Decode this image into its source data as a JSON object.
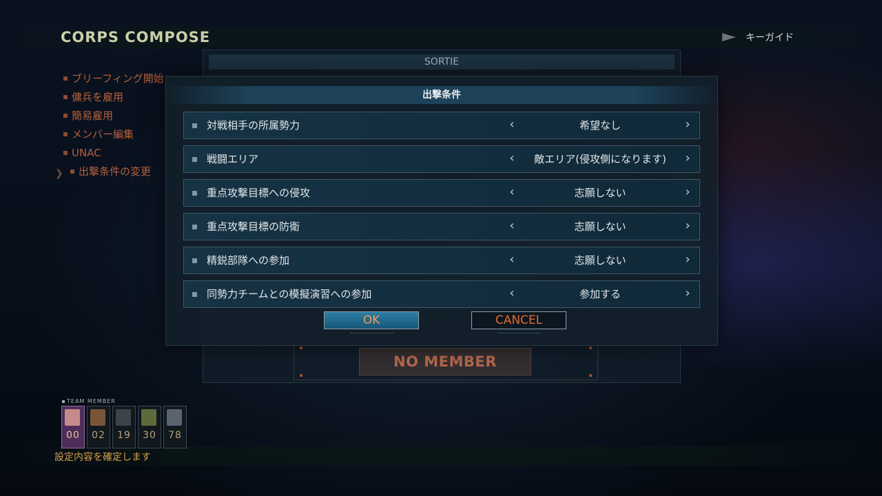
{
  "header": {
    "title": "CORPS COMPOSE",
    "key_guide": "キーガイド"
  },
  "side_menu": [
    {
      "label": "ブリーフィング開始"
    },
    {
      "label": "傭兵を雇用"
    },
    {
      "label": "簡易雇用"
    },
    {
      "label": "メンバー編集"
    },
    {
      "label": "UNAC"
    },
    {
      "label": "出撃条件の変更",
      "active": true
    }
  ],
  "background_panel": {
    "header": "SORTIE",
    "no_member": "NO MEMBER"
  },
  "dialog": {
    "title": "出撃条件",
    "rows": [
      {
        "label": "対戦相手の所属勢力",
        "value": "希望なし"
      },
      {
        "label": "戦闘エリア",
        "value": "敵エリア(侵攻側になります)"
      },
      {
        "label": "重点攻撃目標への侵攻",
        "value": "志願しない"
      },
      {
        "label": "重点攻撃目標の防衛",
        "value": "志願しない"
      },
      {
        "label": "精鋭部隊への参加",
        "value": "志願しない"
      },
      {
        "label": "同勢力チームとの模擬演習への参加",
        "value": "参加する"
      }
    ],
    "ok_label": "OK",
    "cancel_label": "CANCEL"
  },
  "team": {
    "label": "TEAM MEMBER",
    "members": [
      {
        "number": "00",
        "selected": true
      },
      {
        "number": "02"
      },
      {
        "number": "19"
      },
      {
        "number": "30"
      },
      {
        "number": "78"
      }
    ]
  },
  "status_text": "設定内容を確定します",
  "colors": {
    "menu_text": "#b5603e",
    "title_text": "#c9cfa8",
    "ok_button_bg": "#2d7ea3",
    "cancel_text": "#e76a2a",
    "status_text": "#d7a04b"
  }
}
